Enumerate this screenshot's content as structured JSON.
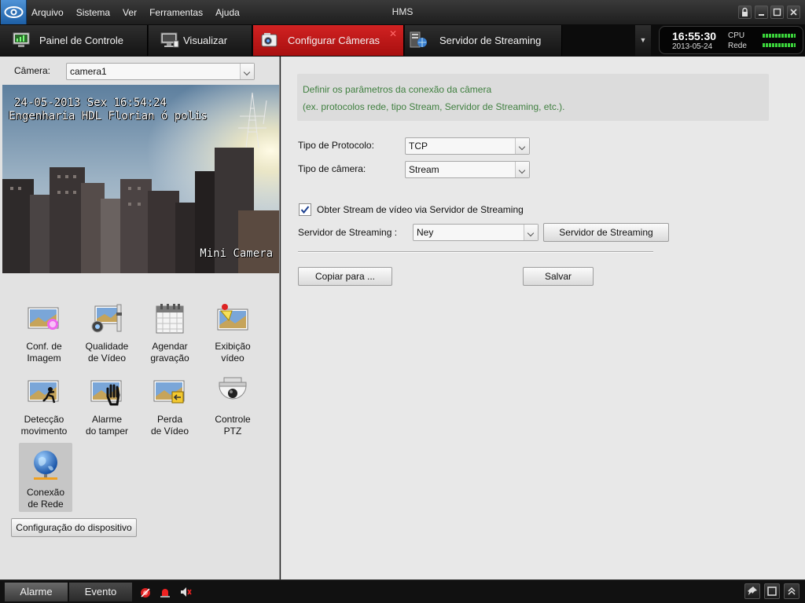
{
  "titlebar": {
    "title": "HMS",
    "menu": [
      "Arquivo",
      "Sistema",
      "Ver",
      "Ferramentas",
      "Ajuda"
    ]
  },
  "tabs": [
    {
      "label": "Painel de Controle",
      "icon": "control-panel-icon"
    },
    {
      "label": "Visualizar",
      "icon": "monitor-icon"
    },
    {
      "label": "Configurar Câmeras",
      "icon": "camera-config-icon",
      "active": true
    },
    {
      "label": "Servidor de Streaming",
      "icon": "streaming-server-icon"
    }
  ],
  "status_panel": {
    "time": "16:55:30",
    "date": "2013-05-24",
    "cpu_label": "CPU",
    "net_label": "Rede"
  },
  "left": {
    "camera_label": "Câmera:",
    "camera_value": "camera1",
    "video": {
      "osd_line1": "24-05-2013 Sex 16:54:24",
      "osd_line2": "Engenharia HDL Florian ó polis",
      "osd_camera": "Mini Camera"
    },
    "grid": [
      {
        "label1": "Conf. de",
        "label2": "Imagem",
        "icon": "image-config-icon"
      },
      {
        "label1": "Qualidade",
        "label2": "de Vídeo",
        "icon": "video-quality-icon"
      },
      {
        "label1": "Agendar",
        "label2": "gravação",
        "icon": "calendar-icon"
      },
      {
        "label1": "Exibição",
        "label2": "vídeo",
        "icon": "video-display-icon"
      },
      {
        "label1": "Detecção",
        "label2": "movimento",
        "icon": "motion-detection-icon"
      },
      {
        "label1": "Alarme",
        "label2": "do tamper",
        "icon": "tamper-alarm-icon"
      },
      {
        "label1": "Perda",
        "label2": "de Vídeo",
        "icon": "video-loss-icon"
      },
      {
        "label1": "Controle",
        "label2": "PTZ",
        "icon": "ptz-camera-icon"
      },
      {
        "label1": "Conexão",
        "label2": "de Rede",
        "icon": "network-globe-icon",
        "selected": true
      }
    ],
    "device_config_button": "Configuração do dispositivo"
  },
  "right": {
    "info_line1": "Definir os parâmetros da conexão da câmera",
    "info_line2": "(ex. protocolos rede, tipo Stream, Servidor de Streaming, etc.).",
    "protocol_label": "Tipo de Protocolo:",
    "protocol_value": "TCP",
    "camera_type_label": "Tipo de câmera:",
    "camera_type_value": "Stream",
    "stream_checkbox_label": "Obter Stream de vídeo via Servidor de Streaming",
    "stream_checkbox_checked": true,
    "server_label": "Servidor de Streaming :",
    "server_value": "Ney",
    "server_button": "Servidor de Streaming",
    "copy_button": "Copiar para ...",
    "save_button": "Salvar"
  },
  "statusbar": {
    "alarm_tab": "Alarme",
    "event_tab": "Evento"
  },
  "colors": {
    "active_tab": "#c01818",
    "info_text": "#3f7f3f",
    "meter": "#3bd43b"
  }
}
